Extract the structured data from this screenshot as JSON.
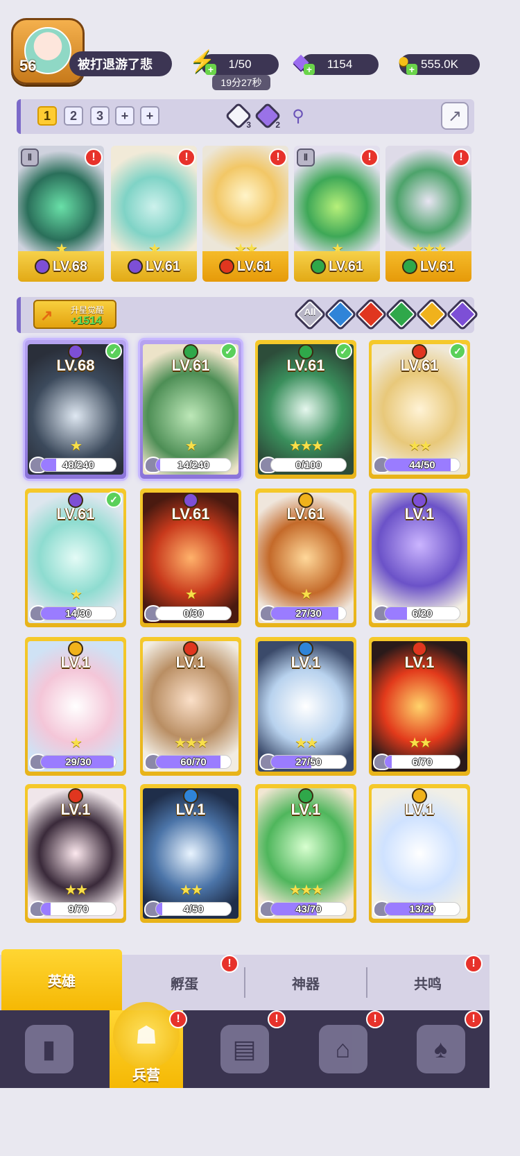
{
  "player": {
    "level": "56",
    "name": "被打退游了悲"
  },
  "resources": {
    "energy": "1/50",
    "energy_timer": "19分27秒",
    "gems": "1154",
    "gold": "555.0K"
  },
  "team_tabs": [
    "1",
    "2",
    "3",
    "+",
    "+"
  ],
  "team_strip": {
    "gem_count_a": "3",
    "gem_count_b": "2"
  },
  "team_cards": [
    {
      "level": "LV.68",
      "element": "purple",
      "stars": "★"
    },
    {
      "level": "LV.61",
      "element": "purple",
      "stars": "★"
    },
    {
      "level": "LV.61",
      "element": "red",
      "stars": "★★"
    },
    {
      "level": "LV.61",
      "element": "green",
      "stars": "★"
    },
    {
      "level": "LV.61",
      "element": "green",
      "stars": "★★★"
    }
  ],
  "filter": {
    "upgrade_label": "升星觉醒",
    "upgrade_value": "+1514",
    "all_label": "All",
    "elements": [
      "blue",
      "red",
      "green",
      "gold",
      "purple"
    ]
  },
  "heroes": [
    {
      "level": "LV.68",
      "progress": "48/240",
      "pct": 0.2,
      "element": "purple",
      "stars": "★",
      "selected": true,
      "check": true
    },
    {
      "level": "LV.61",
      "progress": "14/240",
      "pct": 0.06,
      "element": "green",
      "stars": "★",
      "selected": true,
      "check": true
    },
    {
      "level": "LV.61",
      "progress": "0/100",
      "pct": 0,
      "element": "green",
      "stars": "★★★",
      "check": true
    },
    {
      "level": "LV.61",
      "progress": "44/50",
      "pct": 0.88,
      "element": "red",
      "stars": "★★",
      "check": true
    },
    {
      "level": "LV.61",
      "progress": "14/30",
      "pct": 0.47,
      "element": "purple",
      "stars": "★",
      "check": true
    },
    {
      "level": "LV.61",
      "progress": "0/30",
      "pct": 0,
      "element": "purple",
      "stars": "★",
      "check": false
    },
    {
      "level": "LV.61",
      "progress": "27/30",
      "pct": 0.9,
      "element": "gold",
      "stars": "★",
      "check": false
    },
    {
      "level": "LV.1",
      "progress": "6/20",
      "pct": 0.3,
      "element": "purple",
      "stars": "",
      "check": false
    },
    {
      "level": "LV.1",
      "progress": "29/30",
      "pct": 0.97,
      "element": "gold",
      "stars": "★",
      "check": false
    },
    {
      "level": "LV.1",
      "progress": "60/70",
      "pct": 0.86,
      "element": "red",
      "stars": "★★★",
      "check": false
    },
    {
      "level": "LV.1",
      "progress": "27/50",
      "pct": 0.54,
      "element": "blue",
      "stars": "★★",
      "check": false
    },
    {
      "level": "LV.1",
      "progress": "6/70",
      "pct": 0.09,
      "element": "red",
      "stars": "★★",
      "check": false
    },
    {
      "level": "LV.1",
      "progress": "9/70",
      "pct": 0.13,
      "element": "red",
      "stars": "★★",
      "check": false
    },
    {
      "level": "LV.1",
      "progress": "4/50",
      "pct": 0.08,
      "element": "blue",
      "stars": "★★",
      "check": false
    },
    {
      "level": "LV.1",
      "progress": "43/70",
      "pct": 0.61,
      "element": "green",
      "stars": "★★★",
      "check": false
    },
    {
      "level": "LV.1",
      "progress": "13/20",
      "pct": 0.65,
      "element": "gold",
      "stars": "",
      "check": false
    }
  ],
  "subtabs": [
    "英雄",
    "孵蛋",
    "神器",
    "共鸣"
  ],
  "bottom_nav": {
    "active_label": "兵营"
  },
  "colors": {
    "purple": "#7d4fd6",
    "red": "#e0361f",
    "green": "#2fa84a",
    "blue": "#2f84d8",
    "gold": "#f0b21c"
  }
}
